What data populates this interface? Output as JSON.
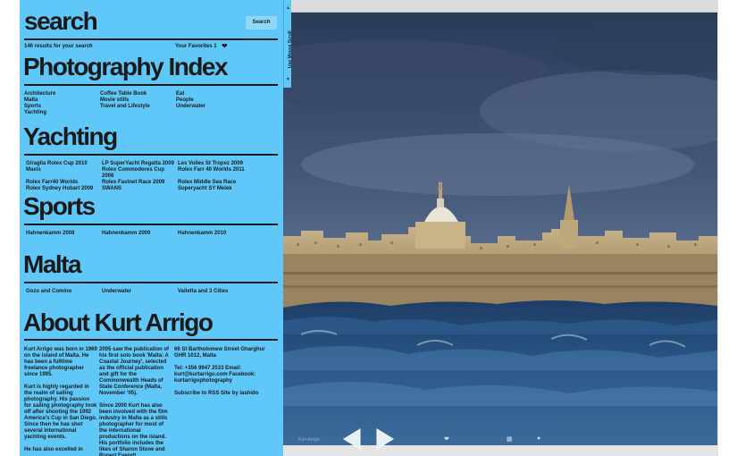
{
  "search": {
    "title": "search",
    "button_label": "Search",
    "results_text": "146 results for your search",
    "favorites_text": "Your Favorites 1",
    "heart_icon": "heart-icon"
  },
  "photography_index": {
    "title": "Photography Index",
    "items": [
      "Architecture",
      "Coffee Table Book",
      "Eat",
      "Malta",
      "Movie stills",
      "People",
      "Sports",
      "Travel and Lifestyle",
      "Underwater",
      "Yachting"
    ]
  },
  "yachting": {
    "title": "Yachting",
    "items": [
      "Giraglia Rolex Cup 2010",
      "LP SuperYacht Regatta 2009",
      "Les Voiles St Tropez 2009",
      "Maxis",
      "Rolex Commodores Cup 2008",
      "Rolex Farr 40 Worlds 2011",
      "Rolex Farr40 Worlds",
      "Rolex Fastnet Race 2009",
      "Rolex Middle Sea Race",
      "Rolex Sydney Hobart 2009",
      "SWANS",
      "Superyacht SY Melek"
    ]
  },
  "sports": {
    "title": "Sports",
    "items": [
      "Hahnenkamm 2008",
      "Hahnenkamm 2009",
      "Hahnenkamm 2010"
    ]
  },
  "malta": {
    "title": "Malta",
    "items": [
      "Gozo and Comino",
      "Underwater",
      "Valletta and 3 Cities"
    ]
  },
  "about": {
    "title": "About Kurt Arrigo",
    "col1": [
      "Kurt Arrigo was born in 1969 on the island of Malta. He has been a fulltime freelance photographer since 1995.",
      "Kurt is highly regarded in the realm of sailing photography. His passion for sailing photography took off after shooting the 1992 America's Cup in San Diego. Since then he has shot several international yachting events.",
      "He has also excelled in"
    ],
    "col2": [
      "2005 saw the publication of his first solo book 'Malta: A Coastal Journey', selected as the official publication and gift for the Commonwealth Heads of State Conference (Malta, November '05).",
      "Since 2000 Kurt has also been involved with the film industry in Malta as a stills photographer for most of the international productions on the island. His portfolio includes the likes of Sharon Stone and Rupert Everett."
    ],
    "col3": [
      "66 St Bartholomew Street Gharghur GHR 1012, Malta",
      "Tel: +356 9947 2533 Email: kurt@kurtarrigo.com Facebook: kurtarrigophotography",
      "Subscribe to RSS Site by iashido"
    ]
  },
  "tab": {
    "label": "Use Mouse Scroll",
    "up_icon": "triangle-up-icon",
    "down_icon": "triangle-down-icon"
  },
  "viewer": {
    "prev_icon": "arrow-left-icon",
    "next_icon": "arrow-right-icon",
    "caption": "Kurt Arrigo",
    "heart_icon": "heart-icon",
    "grid_icon": "grid-icon",
    "dot_icon": "dot-icon"
  },
  "colors": {
    "panel": "#5fc8f9",
    "text": "#1a1a1a"
  }
}
